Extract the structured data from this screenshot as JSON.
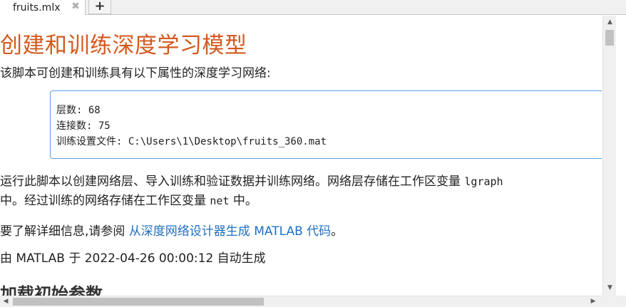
{
  "tabs": [
    {
      "label": "fruits.mlx",
      "close_glyph": "✖"
    }
  ],
  "add_tab_glyph": "+",
  "doc": {
    "title": "创建和训练深度学习模型",
    "intro": "该脚本可创建和训练具有以下属性的深度学习网络:",
    "properties": {
      "layers": "层数: 68",
      "connections": "连接数: 75",
      "settings_file": "训练设置文件: C:\\Users\\1\\Desktop\\fruits_360.mat"
    },
    "run_text_1": "运行此脚本以创建网络层、导入训练和验证数据并训练网络。网络层存储在工作区变量 ",
    "run_code_1": "lgraph",
    "run_text_2": "中。经过训练的网络存储在工作区变量 ",
    "run_code_2": "net",
    "run_text_3": " 中。",
    "more_info_prefix": "要了解详细信息,请参阅 ",
    "more_info_link": "从深度网络设计器生成 MATLAB 代码",
    "more_info_suffix": "。",
    "generated": "由 MATLAB 于 2022-04-26 00:00:12 自动生成",
    "next_heading": "加载初始参数"
  },
  "scrollbars": {
    "up_glyph": "▲",
    "down_glyph": "▼",
    "left_glyph": "◀",
    "right_glyph": "▶"
  },
  "colors": {
    "title": "#d35a1f",
    "link": "#1f6fc2",
    "box_border": "#5aa0e0"
  }
}
